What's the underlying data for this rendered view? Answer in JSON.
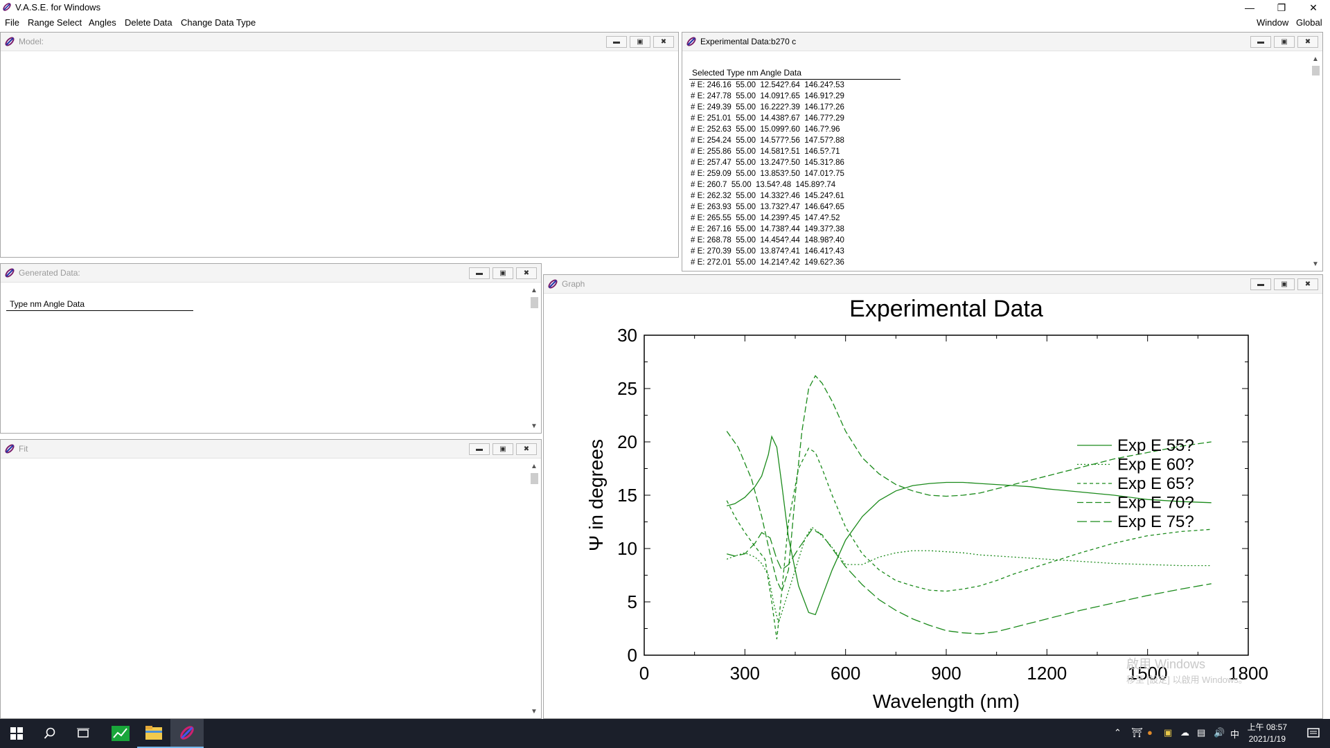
{
  "app": {
    "title": "V.A.S.E. for Windows",
    "menu": [
      "File",
      "Range Select",
      "Angles",
      "Delete Data",
      "Change Data Type"
    ],
    "menu_right": [
      "Window",
      "Global"
    ]
  },
  "windows": {
    "model": {
      "title": "Model:"
    },
    "experimental": {
      "title": "Experimental Data:b270 c",
      "header": "Selected Type  nm  Angle  Data",
      "rows": [
        "# E: 246.16  55.00  12.542?.64  146.24?.53",
        "# E: 247.78  55.00  14.091?.65  146.91?.29",
        "# E: 249.39  55.00  16.222?.39  146.17?.26",
        "# E: 251.01  55.00  14.438?.67  146.77?.29",
        "# E: 252.63  55.00  15.099?.60  146.7?.96",
        "# E: 254.24  55.00  14.577?.56  147.57?.88",
        "# E: 255.86  55.00  14.581?.51  146.5?.71",
        "# E: 257.47  55.00  13.247?.50  145.31?.86",
        "# E: 259.09  55.00  13.853?.50  147.01?.75",
        "# E: 260.7  55.00  13.54?.48  145.89?.74",
        "# E: 262.32  55.00  14.332?.46  145.24?.61",
        "# E: 263.93  55.00  13.732?.47  146.64?.65",
        "# E: 265.55  55.00  14.239?.45  147.4?.52",
        "# E: 267.16  55.00  14.738?.44  149.37?.38",
        "# E: 268.78  55.00  14.454?.44  148.98?.40",
        "# E: 270.39  55.00  13.874?.41  146.41?.43",
        "# E: 272.01  55.00  14.214?.42  149.62?.36"
      ]
    },
    "generated": {
      "title": "Generated Data:",
      "header": "Type  nm  Angle  Data"
    },
    "fit": {
      "title": "Fit"
    },
    "graph": {
      "title": "Graph"
    }
  },
  "chart_data": {
    "type": "line",
    "title": "Experimental Data",
    "xlabel": "Wavelength (nm)",
    "ylabel": "Ψ in degrees",
    "xlim": [
      0,
      1800
    ],
    "ylim": [
      0,
      30
    ],
    "xticks": [
      0,
      300,
      600,
      900,
      1200,
      1500,
      1800
    ],
    "yticks": [
      0,
      5,
      10,
      15,
      20,
      25,
      30
    ],
    "legend_position": "right",
    "color": "#1a8a1a",
    "series": [
      {
        "name": "Exp E 55?",
        "dash": "solid",
        "x": [
          246,
          270,
          300,
          330,
          350,
          370,
          380,
          395,
          410,
          430,
          460,
          490,
          510,
          530,
          560,
          600,
          650,
          700,
          750,
          800,
          850,
          900,
          950,
          1000,
          1050,
          1100,
          1150,
          1200,
          1300,
          1400,
          1500,
          1600,
          1690
        ],
        "y": [
          14.0,
          14.2,
          14.8,
          15.8,
          16.8,
          18.8,
          20.5,
          19.5,
          16.0,
          11.0,
          6.5,
          4.0,
          3.8,
          5.5,
          8.0,
          10.8,
          13.0,
          14.5,
          15.4,
          15.9,
          16.1,
          16.2,
          16.2,
          16.1,
          16.0,
          15.9,
          15.8,
          15.6,
          15.3,
          15.0,
          14.6,
          14.4,
          14.3
        ]
      },
      {
        "name": "Exp E 60?",
        "dash": "2 3",
        "x": [
          246,
          270,
          300,
          330,
          350,
          370,
          385,
          400,
          420,
          450,
          480,
          500,
          520,
          550,
          600,
          650,
          700,
          750,
          800,
          850,
          900,
          950,
          1000,
          1100,
          1200,
          1300,
          1400,
          1500,
          1600,
          1690
        ],
        "y": [
          9.0,
          9.3,
          9.6,
          9.2,
          8.6,
          7.5,
          5.0,
          3.0,
          5.0,
          8.0,
          11.0,
          12.0,
          11.5,
          10.5,
          8.5,
          8.5,
          9.2,
          9.6,
          9.8,
          9.8,
          9.7,
          9.6,
          9.4,
          9.2,
          9.0,
          8.8,
          8.6,
          8.5,
          8.4,
          8.4
        ]
      },
      {
        "name": "Exp E 65?",
        "dash": "5 4",
        "x": [
          246,
          270,
          300,
          330,
          360,
          380,
          395,
          410,
          430,
          460,
          490,
          510,
          530,
          560,
          600,
          650,
          700,
          750,
          800,
          850,
          900,
          950,
          1000,
          1050,
          1100,
          1200,
          1300,
          1400,
          1500,
          1600,
          1690
        ],
        "y": [
          14.5,
          13.0,
          11.5,
          10.2,
          9.0,
          5.0,
          1.5,
          6.0,
          12.5,
          17.5,
          19.4,
          19.0,
          17.5,
          15.0,
          12.0,
          9.5,
          8.0,
          7.0,
          6.5,
          6.1,
          6.0,
          6.2,
          6.5,
          7.0,
          7.6,
          8.6,
          9.6,
          10.5,
          11.2,
          11.6,
          11.8
        ]
      },
      {
        "name": "Exp E 70?",
        "dash": "9 4",
        "x": [
          246,
          280,
          320,
          350,
          375,
          395,
          410,
          430,
          450,
          470,
          490,
          510,
          530,
          560,
          600,
          650,
          700,
          750,
          800,
          850,
          900,
          950,
          1000,
          1050,
          1100,
          1200,
          1300,
          1400,
          1500,
          1600,
          1690
        ],
        "y": [
          21.0,
          19.5,
          16.5,
          13.0,
          9.5,
          7.0,
          6.0,
          8.0,
          15.0,
          21.0,
          25.0,
          26.2,
          25.5,
          23.8,
          21.0,
          18.5,
          17.0,
          16.0,
          15.4,
          15.0,
          14.9,
          15.0,
          15.2,
          15.6,
          16.0,
          16.8,
          17.6,
          18.4,
          19.0,
          19.6,
          20.0
        ]
      },
      {
        "name": "Exp E 75?",
        "dash": "14 5",
        "x": [
          246,
          270,
          300,
          330,
          350,
          375,
          395,
          410,
          430,
          460,
          500,
          530,
          560,
          600,
          650,
          700,
          750,
          800,
          850,
          900,
          950,
          1000,
          1050,
          1100,
          1200,
          1300,
          1400,
          1500,
          1600,
          1690
        ],
        "y": [
          9.5,
          9.3,
          9.5,
          10.5,
          11.5,
          11.0,
          9.0,
          8.0,
          8.5,
          10.0,
          11.8,
          11.3,
          10.0,
          8.3,
          6.6,
          5.2,
          4.2,
          3.4,
          2.8,
          2.3,
          2.1,
          2.0,
          2.2,
          2.6,
          3.4,
          4.2,
          4.9,
          5.6,
          6.2,
          6.7
        ]
      }
    ]
  },
  "watermark": {
    "line1": "啟用 Windows",
    "line2": "移至 [設定] 以啟用 Windows。"
  },
  "taskbar": {
    "ime": "中",
    "time": "上午 08:57",
    "date": "2021/1/19"
  }
}
